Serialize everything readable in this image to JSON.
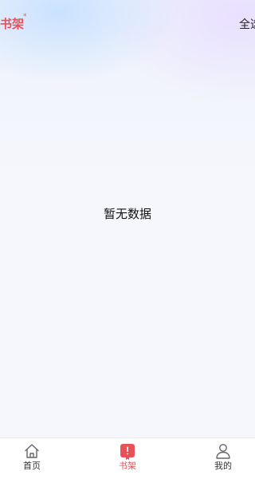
{
  "header": {
    "title": "书架",
    "title_mark": "*",
    "select_all_label": "全选"
  },
  "main": {
    "empty_text": "暂无数据"
  },
  "tabbar": {
    "items": [
      {
        "label": "首页",
        "icon": "home-icon",
        "active": false
      },
      {
        "label": "书架",
        "icon": "bookshelf-icon",
        "active": true
      },
      {
        "label": "我的",
        "icon": "user-icon",
        "active": false
      }
    ]
  },
  "colors": {
    "accent": "#e9515a",
    "background": "#f5f7fc",
    "text": "#111111",
    "icon_inactive": "#666666"
  }
}
